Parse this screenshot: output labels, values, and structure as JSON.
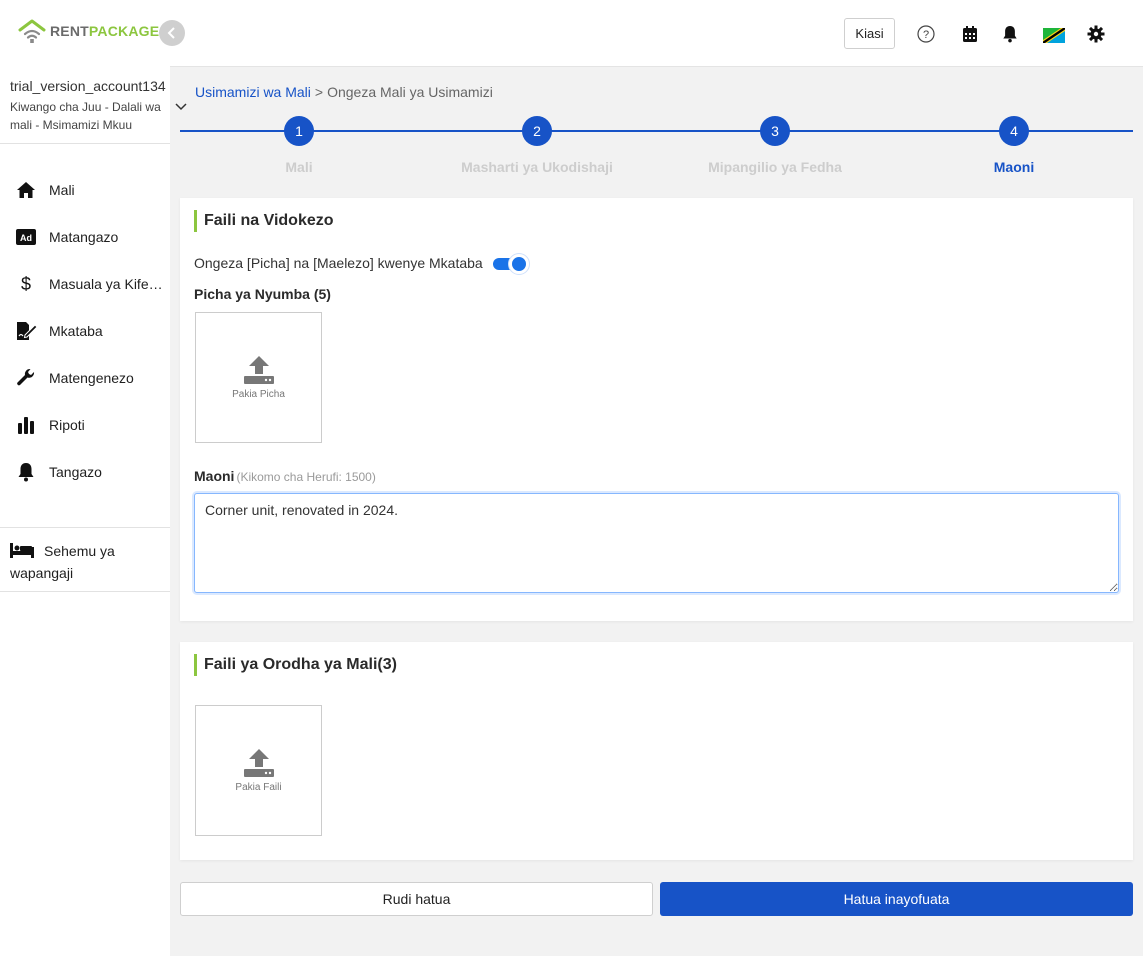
{
  "brand": {
    "part1": "RENT",
    "part2": "PACKAGE",
    "color_primary": "#1753c7",
    "color_accent": "#8cc63f"
  },
  "account": {
    "name": "trial_version_account134",
    "role": "Kiwango cha Juu - Dalali wa mali - Msimamizi Mkuu"
  },
  "sidebar": {
    "items": [
      {
        "label": "Mali",
        "icon": "home-icon"
      },
      {
        "label": "Matangazo",
        "icon": "ad-icon"
      },
      {
        "label": "Masuala ya Kifedha",
        "icon": "dollar-icon"
      },
      {
        "label": "Mkataba",
        "icon": "contract-icon"
      },
      {
        "label": "Matengenezo",
        "icon": "wrench-icon"
      },
      {
        "label": "Ripoti",
        "icon": "bar-chart-icon"
      },
      {
        "label": "Tangazo",
        "icon": "bell-icon"
      }
    ],
    "tenant_section": "Sehemu ya wapangaji"
  },
  "header": {
    "unit_button": "Kiasi"
  },
  "breadcrumb": {
    "parent": "Usimamizi wa Mali",
    "separator": ">",
    "current": "Ongeza Mali ya Usimamizi"
  },
  "stepper": {
    "steps": [
      {
        "number": "1",
        "label": "Mali"
      },
      {
        "number": "2",
        "label": "Masharti ya Ukodishaji"
      },
      {
        "number": "3",
        "label": "Mipangilio ya Fedha"
      },
      {
        "number": "4",
        "label": "Maoni"
      }
    ],
    "active_step": 4
  },
  "files_notes": {
    "title": "Faili na Vidokezo",
    "toggle_label": "Ongeza [Picha] na [Maelezo] kwenye Mkataba",
    "toggle_on": true,
    "photos_label": "Picha ya Nyumba (5)",
    "upload_photo": "Pakia Picha",
    "notes_label": "Maoni",
    "notes_hint": "(Kikomo cha Herufi: 1500)",
    "notes_value": "Corner unit, renovated in 2024."
  },
  "inventory": {
    "title": "Faili ya Orodha ya Mali(3)",
    "upload_file": "Pakia Faili"
  },
  "actions": {
    "back": "Rudi hatua",
    "next": "Hatua inayofuata"
  }
}
